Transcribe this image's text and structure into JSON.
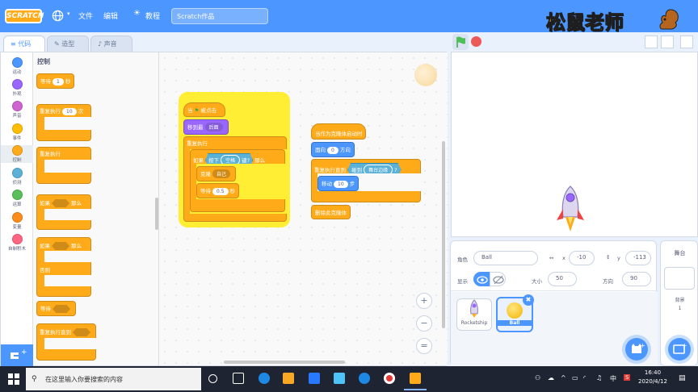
{
  "menubar": {
    "logo": "SCRATCH",
    "file": "文件",
    "edit": "编辑",
    "tutorials": "教程",
    "project_title": "Scratch作品",
    "brand": "松鼠老师"
  },
  "tabs": {
    "code": "代码",
    "costumes": "造型",
    "sounds": "声音"
  },
  "categories": [
    {
      "label": "运动",
      "color": "#4c97ff"
    },
    {
      "label": "外观",
      "color": "#9966ff"
    },
    {
      "label": "声音",
      "color": "#cf63cf"
    },
    {
      "label": "事件",
      "color": "#ffbf00"
    },
    {
      "label": "控制",
      "color": "#ffab19"
    },
    {
      "label": "侦测",
      "color": "#5cb1d6"
    },
    {
      "label": "运算",
      "color": "#59c059"
    },
    {
      "label": "变量",
      "color": "#ff8c1a"
    },
    {
      "label": "自制积木",
      "color": "#ff6680"
    }
  ],
  "palette": {
    "title": "控制",
    "wait": "等待",
    "wait_val": "1",
    "wait_unit": "秒",
    "repeat": "重复执行",
    "repeat_val": "10",
    "repeat_unit": "次",
    "forever": "重复执行",
    "if": "如果",
    "then": "那么",
    "if2": "如果",
    "then2": "那么",
    "else": "否则",
    "wait_until": "等待",
    "repeat_until": "重复执行直到"
  },
  "script1": {
    "hat_when": "当",
    "hat_clicked": "被点击",
    "goto_layer": "移到最",
    "layer_value": "后面",
    "forever": "重复执行",
    "if": "如果",
    "key_pressed": "按下",
    "key": "空格",
    "key_suffix": "键?",
    "then": "那么",
    "clone": "克隆",
    "clone_target": "自己",
    "wait": "等待",
    "wait_val": "0.5",
    "wait_unit": "秒"
  },
  "script2": {
    "hat": "当作为克隆体启动时",
    "point": "面向",
    "point_val": "0",
    "point_unit": "方向",
    "repeat_until": "重复执行直到",
    "touching": "碰到",
    "touching_val": "舞台边缘",
    "touching_q": "?",
    "move": "移动",
    "move_val": "10",
    "move_unit": "步",
    "delete": "删除此克隆体"
  },
  "zoom": {
    "in": "+",
    "out": "−",
    "reset": "="
  },
  "sprite_info": {
    "sprite_label": "角色",
    "sprite_name": "Ball",
    "x_label": "x",
    "x_val": "-10",
    "y_label": "y",
    "y_val": "-113",
    "show_label": "显示",
    "size_label": "大小",
    "size_val": "50",
    "dir_label": "方向",
    "dir_val": "90"
  },
  "sprites": [
    {
      "name": "Rocketship"
    },
    {
      "name": "Ball"
    }
  ],
  "stage_panel": {
    "title": "舞台",
    "backdrops_label": "背景",
    "backdrops_count": "1"
  },
  "taskbar": {
    "search_placeholder": "在这里输入你要搜索的内容",
    "time": "16:40",
    "date": "2020/4/12",
    "ime": "中",
    "s": "S"
  }
}
